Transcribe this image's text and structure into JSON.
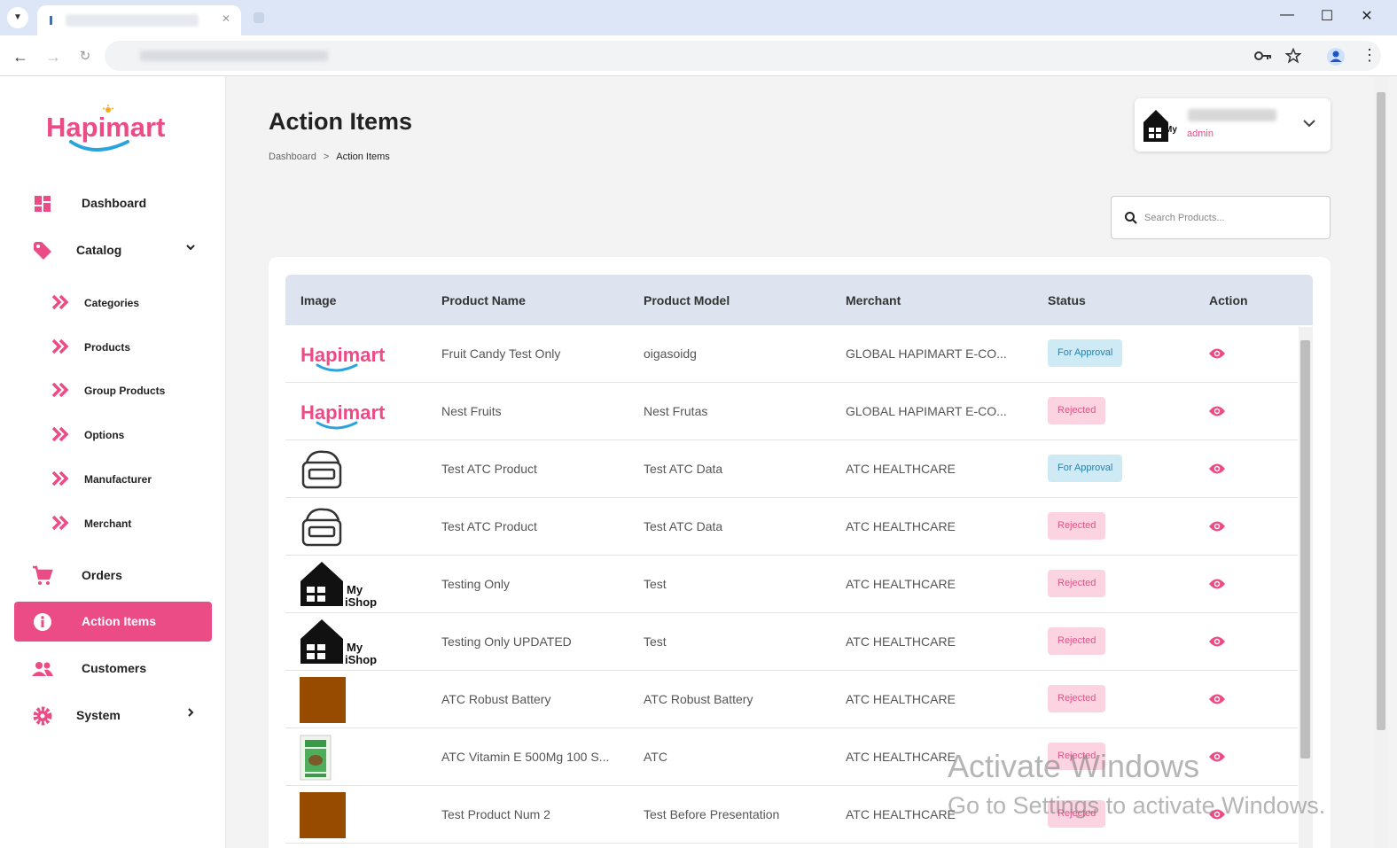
{
  "browser": {
    "window_controls": {
      "minimize": "—",
      "maximize": "☐",
      "close": "✕"
    }
  },
  "sidebar": {
    "logo_text": "Hapimart",
    "items": [
      {
        "label": "Dashboard",
        "icon": "dashboard-icon"
      },
      {
        "label": "Catalog",
        "icon": "tag-icon",
        "expanded": true
      },
      {
        "label": "Orders",
        "icon": "cart-icon"
      },
      {
        "label": "Action Items",
        "icon": "info-icon",
        "active": true
      },
      {
        "label": "Customers",
        "icon": "people-icon"
      },
      {
        "label": "System",
        "icon": "gear-icon"
      }
    ],
    "catalog_sub": [
      {
        "label": "Categories"
      },
      {
        "label": "Products"
      },
      {
        "label": "Group Products"
      },
      {
        "label": "Options"
      },
      {
        "label": "Manufacturer"
      },
      {
        "label": "Merchant"
      }
    ]
  },
  "header": {
    "title": "Action Items",
    "breadcrumb": {
      "home": "Dashboard",
      "sep": ">",
      "current": "Action Items"
    },
    "user": {
      "role": "admin",
      "avatar_text": "My iShop"
    }
  },
  "search": {
    "placeholder": "Search Products..."
  },
  "table": {
    "headers": {
      "image": "Image",
      "name": "Product Name",
      "model": "Product Model",
      "merchant": "Merchant",
      "status": "Status",
      "action": "Action"
    },
    "rows": [
      {
        "name": "Fruit Candy Test Only",
        "model": "oigasoidg",
        "merchant": "GLOBAL HAPIMART E-CO...",
        "status": "For Approval"
      },
      {
        "name": "Nest Fruits",
        "model": "Nest Frutas",
        "merchant": "GLOBAL HAPIMART E-CO...",
        "status": "Rejected"
      },
      {
        "name": "Test ATC Product",
        "model": "Test ATC Data",
        "merchant": "ATC HEALTHCARE",
        "status": "For Approval"
      },
      {
        "name": "Test ATC Product",
        "model": "Test ATC Data",
        "merchant": "ATC HEALTHCARE",
        "status": "Rejected"
      },
      {
        "name": "Testing Only",
        "model": "Test",
        "merchant": "ATC HEALTHCARE",
        "status": "Rejected"
      },
      {
        "name": "Testing Only UPDATED",
        "model": "Test",
        "merchant": "ATC HEALTHCARE",
        "status": "Rejected"
      },
      {
        "name": "ATC Robust Battery",
        "model": "ATC Robust Battery",
        "merchant": "ATC HEALTHCARE",
        "status": "Rejected"
      },
      {
        "name": "ATC Vitamin E 500Mg 100 S...",
        "model": "ATC",
        "merchant": "ATC HEALTHCARE",
        "status": "Rejected"
      },
      {
        "name": "Test Product Num 2",
        "model": "Test Before Presentation",
        "merchant": "ATC HEALTHCARE",
        "status": "Rejected"
      }
    ]
  },
  "watermark": {
    "line1": "Activate Windows",
    "line2": "Go to Settings to activate Windows."
  },
  "colors": {
    "accent": "#ec4c86",
    "approval_bg": "#cdeaf5",
    "rejected_bg": "#fbd3e1",
    "header_bg": "#dde4ef"
  }
}
